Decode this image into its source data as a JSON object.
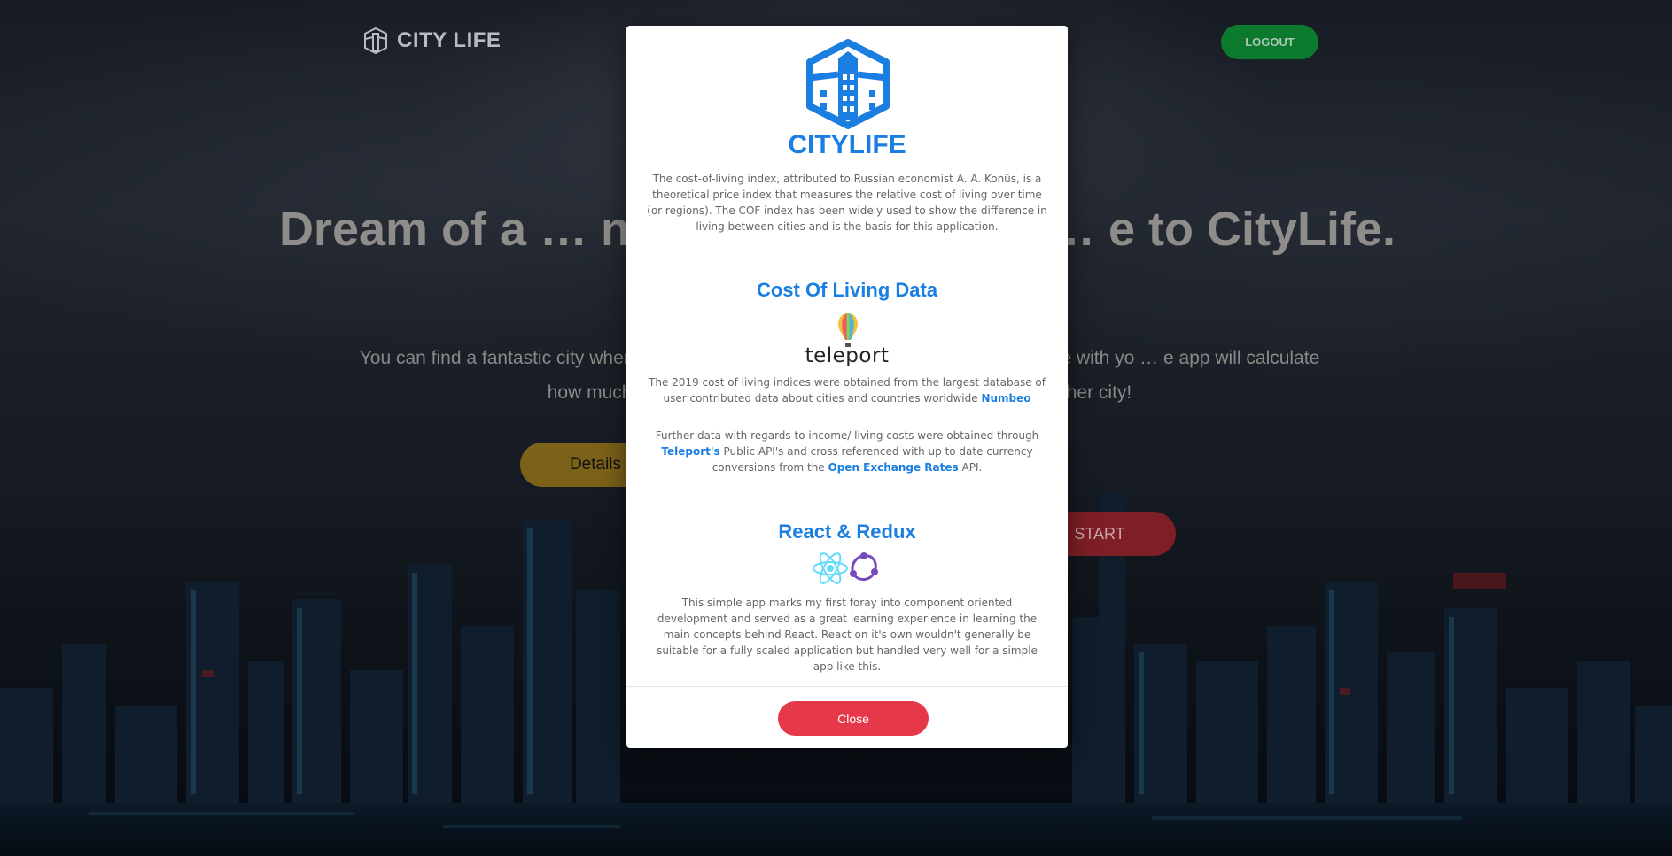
{
  "header": {
    "brand_name": "CITY LIFE",
    "logout_label": "LOGOUT"
  },
  "hero": {
    "title": "Dream of a … nie Kenth! beautifu … e to CityLife.",
    "text": "You can find a fantastic city wher … your current salary will go in life. Make a better life with yo … e app will calculate how much … d need in order to maintain the … of living in another city!",
    "details_label": "Details",
    "start_label": "START"
  },
  "modal": {
    "title": "CITYLIFE",
    "intro": "The cost-of-living index, attributed to Russian economist A. A. Konüs, is a theoretical price index that measures the relative cost of living over time (or regions). The COF index has been widely used to show the difference in living between cities and is the basis for this application.",
    "section1_title": "Cost Of Living Data",
    "teleport_logo_text": "teleport",
    "numbeo_text": "The  2019 cost of living indices were obtained from the largest database of user contributed data about cities and countries worldwide",
    "numbeo_link": "Numbeo",
    "teleport_text_a": "Further data with regards to income/ living costs were obtained through",
    "teleport_link": "Teleport's",
    "teleport_text_b": "Public API's and cross referenced with up to date currency conversions from the",
    "oer_link": "Open Exchange Rates",
    "teleport_text_c": "API.",
    "section2_title": "React & Redux",
    "react_text": "This simple app marks my first foray into component oriented development and served as a great learning experience in learning the main concepts behind React. React on it's own wouldn't generally be suitable for a fully scaled application but handled very well for a simple app like this.",
    "close_label": "Close"
  },
  "icons": {
    "brand": "city-logo-icon",
    "modal_logo": "city-building-icon",
    "teleport": "teleport-balloon-icon",
    "react": "react-atom-icon",
    "redux": "redux-icon"
  },
  "colors": {
    "accent_blue": "#1a7fe0",
    "logout_green": "#0b7a2e",
    "close_red": "#e5394a",
    "details_gold": "#7c6219",
    "start_red": "#7e1f26"
  }
}
